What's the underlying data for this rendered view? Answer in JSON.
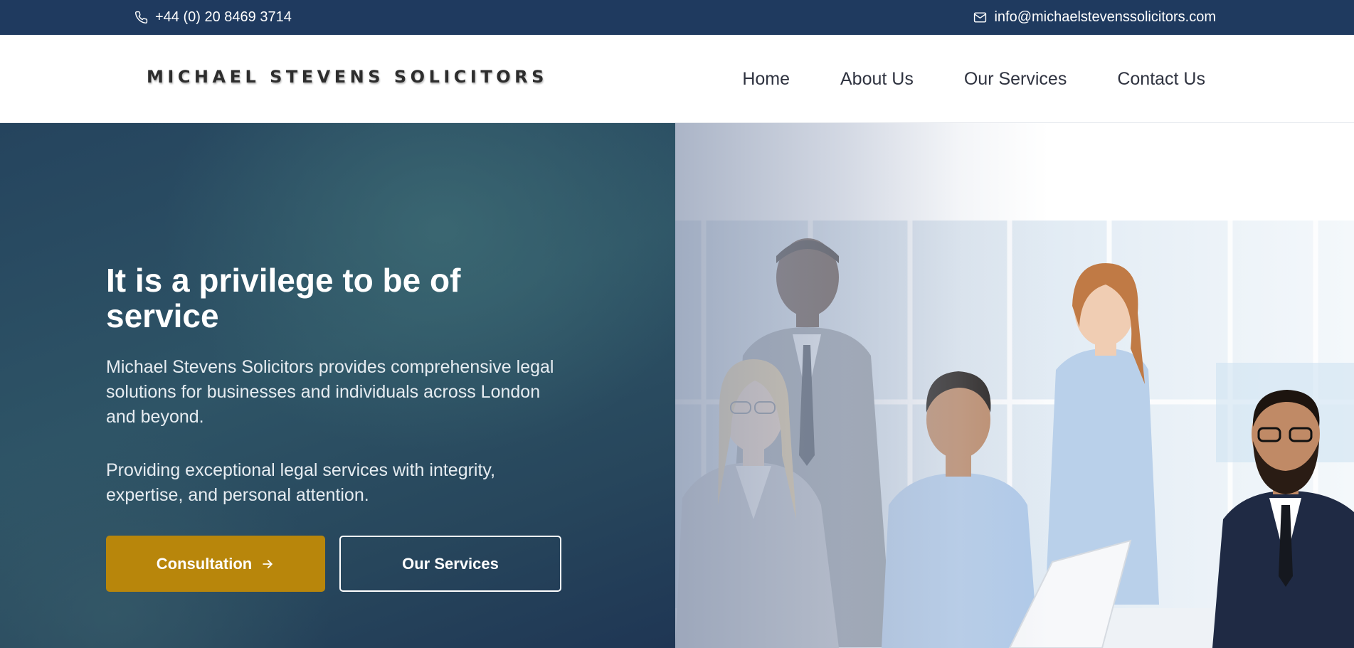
{
  "topbar": {
    "phone": "+44 (0) 20 8469 3714",
    "email": "info@michaelstevenssolicitors.com",
    "phone_icon": "phone-icon",
    "email_icon": "mail-icon"
  },
  "header": {
    "logo": "MICHAEL STEVENS SOLICITORS",
    "nav": [
      "Home",
      "About Us",
      "Our Services",
      "Contact Us"
    ]
  },
  "hero": {
    "title": "It is a privilege to be of service",
    "description": "Michael Stevens Solicitors provides comprehensive legal solutions for businesses and individuals across London and beyond.",
    "tagline": "Providing exceptional legal services with integrity, expertise, and personal attention.",
    "primary_button": "Consultation",
    "secondary_button": "Our Services",
    "primary_button_icon": "arrow-right-icon",
    "image": "team-photo"
  },
  "colors": {
    "topbar": "#1f3a5f",
    "accent": "#b8860b",
    "hero_dark": "#25445e",
    "hero_teal": "#2e5466"
  }
}
